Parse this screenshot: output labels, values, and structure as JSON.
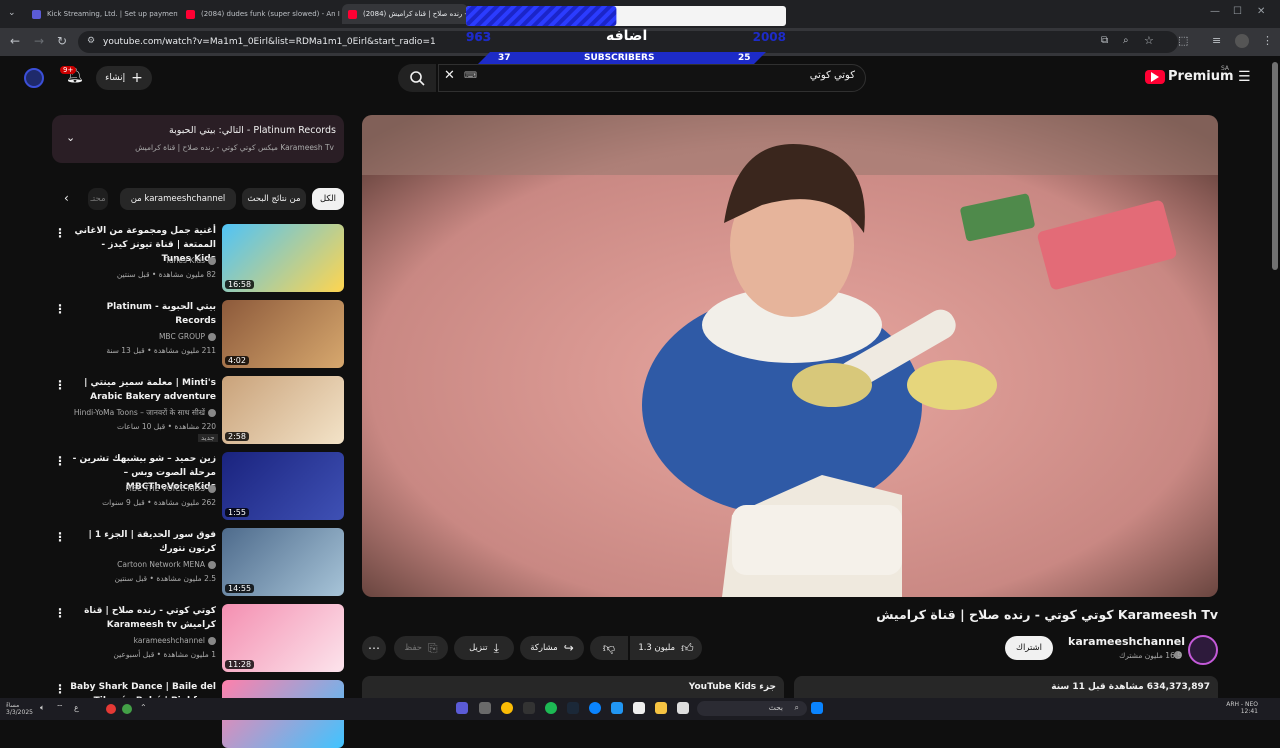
{
  "browser": {
    "tabs": [
      {
        "title": "Kick Streaming, Ltd. | Set up payments wit",
        "color": "#5b5bd6"
      },
      {
        "title": "(2084) dudes funk (super slowed) - An In",
        "color": "#ff0033"
      },
      {
        "title": "(2084) كوتي كوتي - رنده صلاح | قناة كراميش",
        "color": "#ff0033"
      }
    ],
    "url": "youtube.com/watch?v=Ma1m1_0Eirl&list=RDMa1m1_0Eirl&start_radio=1"
  },
  "overlay": {
    "label": "اضافه",
    "left_count": "963",
    "right_count": "2008",
    "current": "37",
    "goal": "25",
    "caption": "SUBSCRIBERS",
    "progress": 0.47
  },
  "header": {
    "create_label": "إنشاء",
    "notification_count": "9+",
    "search_value": "كوتي كوتي",
    "logo_text": "Premium",
    "region": "SA"
  },
  "queue": {
    "title": "التالي: بيتي الحبوبة - Platinum Records",
    "subtitle": "ميكس كوتي كوتي - رنده صلاح | قناة كراميش Karameesh Tv"
  },
  "chips": [
    {
      "label": "الكل",
      "selected": true
    },
    {
      "label": "من نتائج البحث",
      "selected": false
    },
    {
      "label": "من karameeshchannel",
      "selected": false
    },
    {
      "label": "محتـ",
      "selected": false
    }
  ],
  "recommendations": [
    {
      "title": "أغنية جمل ومجموعة من الاغاني الممتعة | قناة تيونز كيدز - Tunes Kids",
      "channel": "Tunes Kids",
      "meta": "82 مليون مشاهدة • قبل سنتين",
      "duration": "16:58",
      "colors": [
        "#4fc3f7",
        "#ffd54f"
      ]
    },
    {
      "title": "بيتي الحبوبة - Platinum Records",
      "channel": "MBC GROUP",
      "meta": "211 مليون مشاهدة • قبل 13 سنة",
      "duration": "4:02",
      "colors": [
        "#8d5a3b",
        "#d7a86e"
      ]
    },
    {
      "title": "Minti's | معلمة سميز مينتي | Arabic Bakery adventure",
      "channel": "Hindi-YoMa Toons – जानवरों के साथ सीखें",
      "meta": "220 مشاهدة • قبل 10 ساعات",
      "duration": "2:58",
      "colors": [
        "#c9a27a",
        "#f3e3c8"
      ],
      "badge": "جديد"
    },
    {
      "title": "زين حميد – شو بيشبهك تشرين - مرحلة الصوت وبس – MBCTheVoiceKids",
      "channel": "MBC THE VOICE KIDS",
      "meta": "262 مليون مشاهدة • قبل 9 سنوات",
      "duration": "1:55",
      "colors": [
        "#1a237e",
        "#3f51b5"
      ]
    },
    {
      "title": "فوق سور الحديقة | الجزء 1 | كرتون نتورك",
      "channel": "Cartoon Network MENA",
      "meta": "2.5 مليون مشاهدة • قبل سنتين",
      "duration": "14:55",
      "colors": [
        "#4e6b8c",
        "#a7c4d8"
      ]
    },
    {
      "title": "كوتي كوتي - رنده صلاح | قناة كراميش Karameesh tv",
      "channel": "karameeshchannel",
      "meta": "1 مليون مشاهدة • قبل أسبوعين",
      "duration": "11:28",
      "colors": [
        "#f48fb1",
        "#fce4ec"
      ]
    },
    {
      "title": "Baby Shark Dance | Baile del Tiburón Bebé | Pinkfong",
      "channel": "",
      "meta": "",
      "duration": "",
      "colors": [
        "#ff80ab",
        "#40c4ff"
      ]
    }
  ],
  "video": {
    "title": "كوتي كوتي - رنده صلاح | قناة كراميش Karameesh Tv",
    "channel": "karameeshchannel",
    "subscribers": "16.9 مليون مشترك",
    "subscribe_label": "اشتراك",
    "likes": "1.3 مليون",
    "share_label": "مشاركة",
    "download_label": "تنزيل",
    "save_label": "حفظ",
    "views": "634,373,897 مشاهدة قبل 11 سنة",
    "kids_label": "جزء YouTube Kids"
  },
  "taskbar": {
    "search_label": "بحث",
    "time": "ARH - NEO",
    "date": "12:41",
    "left_time": "مساءً",
    "left_date": "3/3/2025"
  }
}
